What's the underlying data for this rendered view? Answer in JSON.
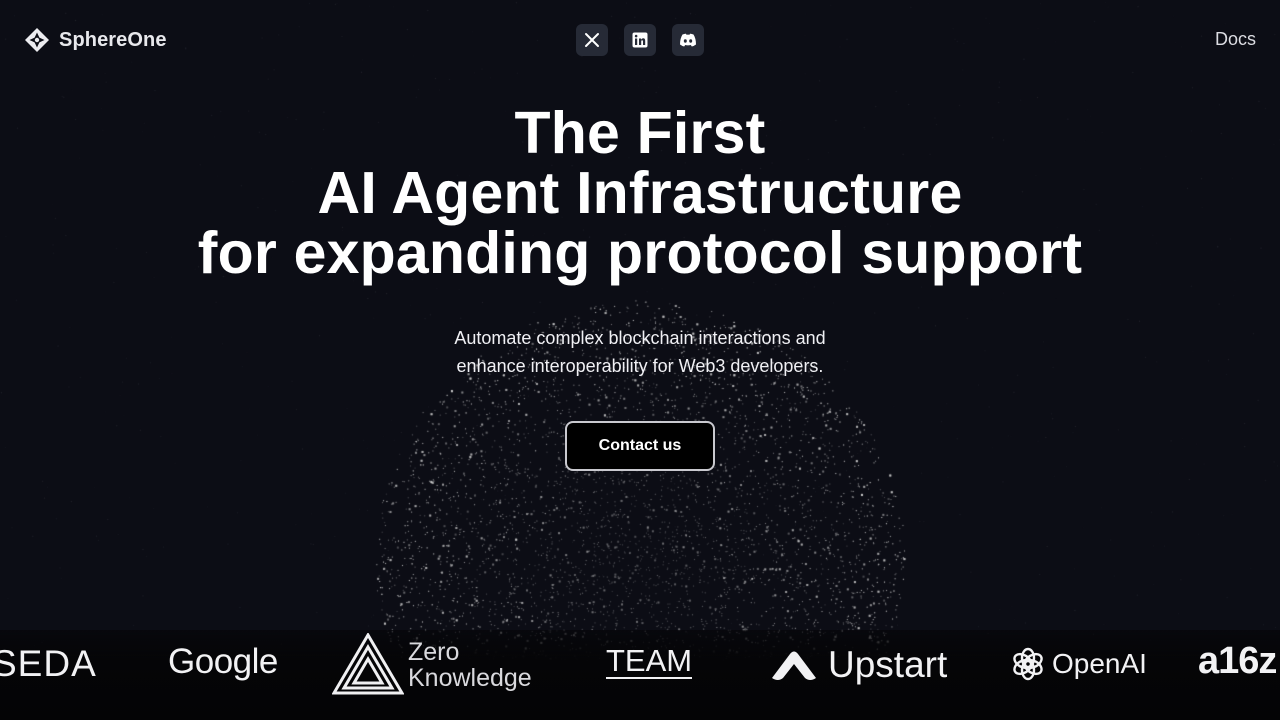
{
  "header": {
    "brand": "SphereOne",
    "social": [
      "x-icon",
      "linkedin-icon",
      "discord-icon"
    ],
    "docs_label": "Docs"
  },
  "hero": {
    "title_lines": [
      "The First",
      "AI Agent Infrastructure",
      "for expanding protocol support"
    ],
    "subtitle_lines": [
      "Automate complex blockchain interactions and",
      "enhance interoperability for Web3 developers."
    ],
    "cta_label": "Contact us"
  },
  "partners": {
    "seda": "SEDA",
    "google": "Google",
    "zero_knowledge_lines": [
      "Zero",
      "Knowledge"
    ],
    "team": "TEAM",
    "upstart": "Upstart",
    "openai": "OpenAI",
    "a16z": "a16z"
  },
  "colors": {
    "background": "#0c0d15",
    "social_button": "#262a36",
    "cta_border": "#c9c9cf",
    "particles": "#d8d8d8"
  }
}
